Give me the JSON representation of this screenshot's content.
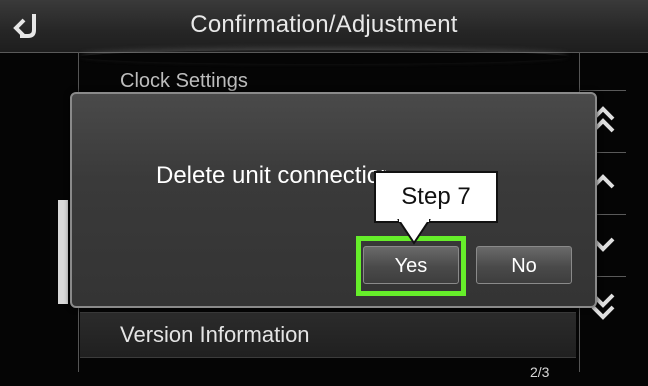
{
  "header": {
    "title": "Confirmation/Adjustment"
  },
  "list": {
    "peek_item": "Clock Settings",
    "version_item": "Version Information",
    "page_indicator": "2/3"
  },
  "dialog": {
    "message": "Delete unit connection?",
    "yes_label": "Yes",
    "no_label": "No"
  },
  "annotation": {
    "callout_text": "Step 7",
    "highlight_color": "#66ee2a"
  },
  "icons": [
    "back-arrow-icon",
    "double-chevron-up-icon",
    "chevron-up-icon",
    "chevron-down-icon",
    "double-chevron-down-icon"
  ]
}
